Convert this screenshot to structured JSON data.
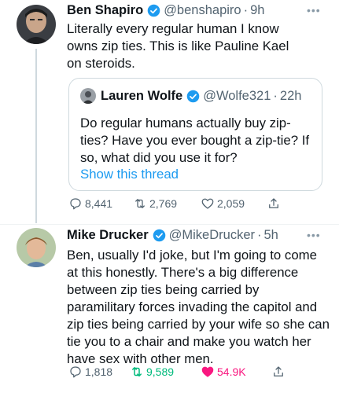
{
  "tweet1": {
    "name": "Ben Shapiro",
    "handle": "@benshapiro",
    "time": "9h",
    "body": "Literally every regular human I know owns zip ties. This is like Pauline Kael on steroids.",
    "quote": {
      "name": "Lauren Wolfe",
      "handle": "@Wolfe321",
      "time": "22h",
      "body": "Do regular humans actually buy zip-ties? Have you ever bought a zip-tie? If so, what did you use it for?",
      "show_thread": "Show this thread"
    },
    "replies": "8,441",
    "retweets": "2,769",
    "likes": "2,059"
  },
  "tweet2": {
    "name": "Mike Drucker",
    "handle": "@MikeDrucker",
    "time": "5h",
    "body": "Ben, usually I'd joke, but I'm going to come at this honestly. There's a big difference between zip ties being carried by paramilitary forces invading the capitol and zip ties being carried by your wife so she can tie you to a chair and make you watch her have sex with other men.",
    "replies": "1,818",
    "retweets": "9,589",
    "likes": "54.9K"
  },
  "dot": "·",
  "more_glyph": "•••",
  "icons": {
    "verified": "verified-badge-icon",
    "reply": "reply-icon",
    "retweet": "retweet-icon",
    "like": "heart-icon",
    "share": "share-icon",
    "more": "more-icon"
  },
  "colors": {
    "verified": "#1d9bf0",
    "link": "#1d9bf0",
    "retweeted": "#00ba7c",
    "liked": "#f91880",
    "secondary": "#536471"
  }
}
